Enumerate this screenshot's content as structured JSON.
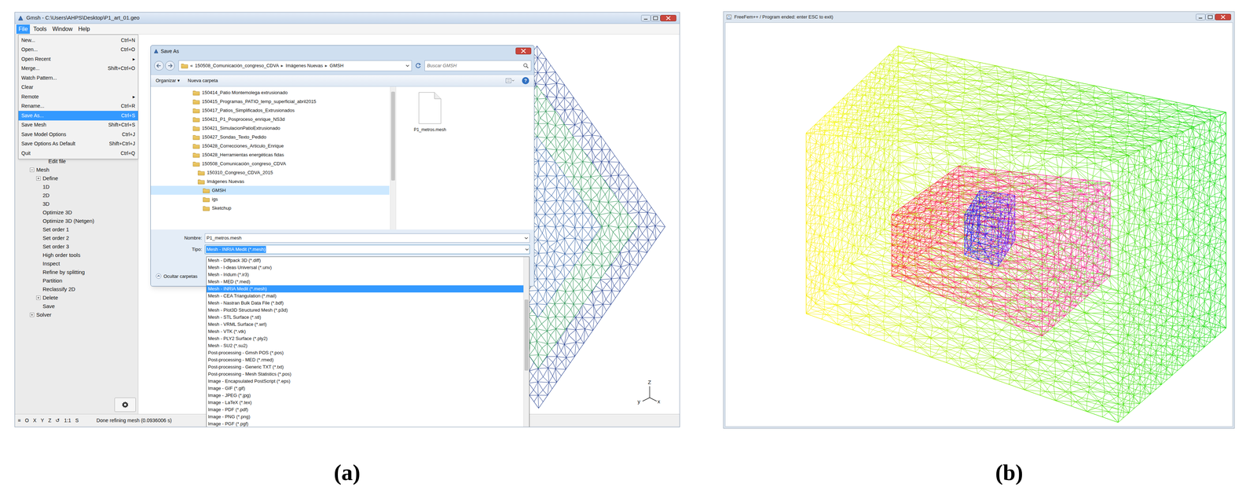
{
  "panels": [
    {
      "caption": "(a)"
    },
    {
      "caption": "(b)"
    }
  ],
  "gmsh": {
    "title": "Gmsh - C:\\Users\\AHPS\\Desktop\\P1_art_01.geo",
    "menubar": [
      {
        "label": "File",
        "selected": true
      },
      {
        "label": "Tools",
        "selected": false
      },
      {
        "label": "Window",
        "selected": false
      },
      {
        "label": "Help",
        "selected": false
      }
    ],
    "file_menu": [
      {
        "label": "New...",
        "shortcut": "Ctrl+N",
        "selected": false
      },
      {
        "label": "Open...",
        "shortcut": "Ctrl+O",
        "selected": false
      },
      {
        "label": "Open Recent",
        "arrow": "▸",
        "selected": false
      },
      {
        "label": "Merge...",
        "shortcut": "Shift+Ctrl+O",
        "selected": false
      },
      {
        "label": "Watch Pattern...",
        "selected": false
      },
      {
        "label": "Clear",
        "selected": false
      },
      {
        "label": "Remote",
        "arrow": "▸",
        "selected": false
      },
      {
        "label": "Rename...",
        "shortcut": "Ctrl+R",
        "selected": false
      },
      {
        "label": "Save As...",
        "shortcut": "Ctrl+S",
        "selected": true
      },
      {
        "label": "Save Mesh",
        "shortcut": "Shift+Ctrl+S",
        "selected": false
      },
      {
        "label": "Save Model Options",
        "shortcut": "Ctrl+J",
        "selected": false
      },
      {
        "label": "Save Options As Default",
        "shortcut": "Shift+Ctrl+J",
        "selected": false
      },
      {
        "label": "Quit",
        "shortcut": "Ctrl+Q",
        "selected": false
      }
    ],
    "tree": {
      "cut_item": "Edit file",
      "items": [
        {
          "label": "Mesh",
          "expanded": true,
          "children": [
            {
              "label": "Define",
              "expanded": false
            },
            {
              "label": "1D"
            },
            {
              "label": "2D"
            },
            {
              "label": "3D"
            },
            {
              "label": "Optimize 3D"
            },
            {
              "label": "Optimize 3D (Netgen)"
            },
            {
              "label": "Set order 1"
            },
            {
              "label": "Set order 2"
            },
            {
              "label": "Set order 3"
            },
            {
              "label": "High order tools"
            },
            {
              "label": "Inspect"
            },
            {
              "label": "Refine by splitting"
            },
            {
              "label": "Partition"
            },
            {
              "label": "Reclassify 2D"
            },
            {
              "label": "Delete",
              "expanded": false
            },
            {
              "label": "Save"
            }
          ]
        },
        {
          "label": "Solver",
          "expanded": false
        }
      ]
    },
    "status_bar": {
      "buttons": [
        "≡",
        "O",
        "X",
        "Y",
        "Z",
        "↺",
        "1:1",
        "S"
      ],
      "message": "Done refining mesh (0.0936006 s)"
    },
    "axes": {
      "z": "Z",
      "y": "y",
      "x": "x"
    }
  },
  "save_dialog": {
    "title": "Save As",
    "address": {
      "prefix": "«",
      "segments": [
        "150508_Comunicación_congreso_CDVA",
        "Imágenes Nuevas",
        "GMSH"
      ],
      "separator": "▸"
    },
    "search": {
      "placeholder": "Buscar GMSH"
    },
    "toolbar": {
      "organize": "Organizar",
      "organize_arrow": "▾",
      "new_folder": "Nueva carpeta",
      "help": "?"
    },
    "folders": [
      {
        "label": "150414_Patio Montemolega extrusionado",
        "selected": false
      },
      {
        "label": "150415_Programas_PATIO_temp_superficial_abril2015",
        "selected": false
      },
      {
        "label": "150417_Patios_Simplificados_Extrusionados",
        "selected": false
      },
      {
        "label": "150421_P1_Posproceso_enrique_NS3d",
        "selected": false
      },
      {
        "label": "150421_SimulacionPatioExtrusionado",
        "selected": false
      },
      {
        "label": "150427_Sondas_Texto_Pedido",
        "selected": false
      },
      {
        "label": "150428_Correcciones_Articulo_Enrique",
        "selected": false
      },
      {
        "label": "150428_Herramientas energéticas fidas",
        "selected": false
      },
      {
        "label": "150508_Comunicación_congreso_CDVA",
        "selected": false,
        "children": [
          {
            "label": "150310_Congreso_CDVA_2015",
            "selected": false
          },
          {
            "label": "Imágenes Nuevas",
            "selected": false,
            "children": [
              {
                "label": "GMSH",
                "selected": true
              },
              {
                "label": "igs",
                "selected": false
              },
              {
                "label": "Sketchup",
                "selected": false
              }
            ]
          }
        ]
      }
    ],
    "files": [
      {
        "name": "P1_metros.mesh"
      }
    ],
    "name_label": "Nombre:",
    "name_value": "P1_metros.mesh",
    "type_label": "Tipo:",
    "type_value": "Mesh - INRIA Medit (*.mesh)",
    "hide_folders": "Ocultar carpetas"
  },
  "type_dropdown": [
    {
      "label": "Mesh - Diffpack 3D (*.diff)",
      "selected": false
    },
    {
      "label": "Mesh - I-deas Universal (*.unv)",
      "selected": false
    },
    {
      "label": "Mesh - Iridum (*.ir3)",
      "selected": false
    },
    {
      "label": "Mesh - MED (*.med)",
      "selected": false
    },
    {
      "label": "Mesh - INRIA Medit (*.mesh)",
      "selected": true
    },
    {
      "label": "Mesh - CEA Triangulation (*.mail)",
      "selected": false
    },
    {
      "label": "Mesh - Nastran Bulk Data File (*.bdf)",
      "selected": false
    },
    {
      "label": "Mesh - Plot3D Structured Mesh (*.p3d)",
      "selected": false
    },
    {
      "label": "Mesh - STL Surface (*.stl)",
      "selected": false
    },
    {
      "label": "Mesh - VRML Surface (*.wrl)",
      "selected": false
    },
    {
      "label": "Mesh - VTK (*.vtk)",
      "selected": false
    },
    {
      "label": "Mesh - PLY2 Surface (*.ply2)",
      "selected": false
    },
    {
      "label": "Mesh - SU2 (*.su2)",
      "selected": false
    },
    {
      "label": "Post-processing - Gmsh POS (*.pos)",
      "selected": false
    },
    {
      "label": "Post-processing - MED (*.rmed)",
      "selected": false
    },
    {
      "label": "Post-processing - Generic TXT (*.txt)",
      "selected": false
    },
    {
      "label": "Post-processing - Mesh Statistics (*.pos)",
      "selected": false
    },
    {
      "label": "Image - Encapsulated PostScript (*.eps)",
      "selected": false
    },
    {
      "label": "Image - GIF (*.gif)",
      "selected": false
    },
    {
      "label": "Image - JPEG (*.jpg)",
      "selected": false
    },
    {
      "label": "Image - LaTeX (*.tex)",
      "selected": false
    },
    {
      "label": "Image - PDF (*.pdf)",
      "selected": false
    },
    {
      "label": "Image - PNG (*.png)",
      "selected": false
    },
    {
      "label": "Image - PGF (*.pgf)",
      "selected": false
    }
  ],
  "freefem": {
    "title": "FreeFem++ / Program ended: enter ESC to exit)"
  }
}
